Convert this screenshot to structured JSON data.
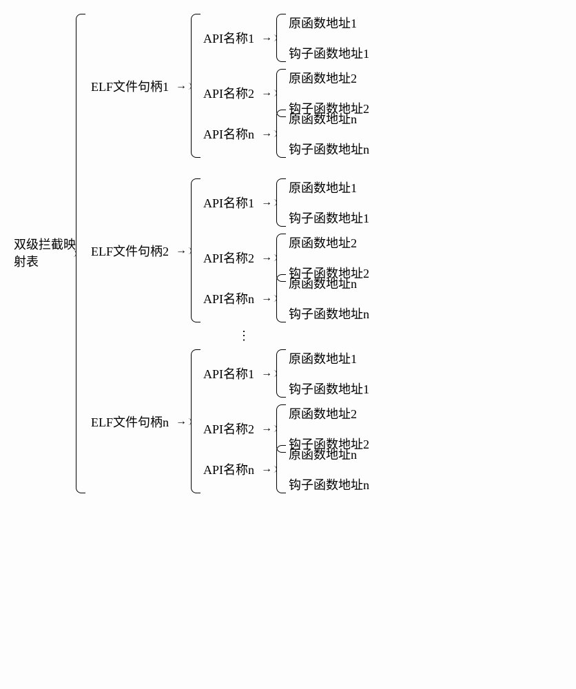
{
  "root": "双级拦截映射表",
  "arrow": "→",
  "vellipsis": "⋮",
  "elf": [
    {
      "label": "ELF文件句柄1"
    },
    {
      "label": "ELF文件句柄2"
    },
    {
      "label": "ELF文件句柄n"
    }
  ],
  "apis": [
    {
      "label": "API名称1",
      "leaves": [
        "原函数地址1",
        "钩子函数地址1"
      ]
    },
    {
      "label": "API名称2",
      "leaves": [
        "原函数地址2",
        "钩子函数地址2"
      ]
    },
    {
      "label": "API名称n",
      "leaves": [
        "原函数地址n",
        "钩子函数地址n"
      ]
    }
  ]
}
